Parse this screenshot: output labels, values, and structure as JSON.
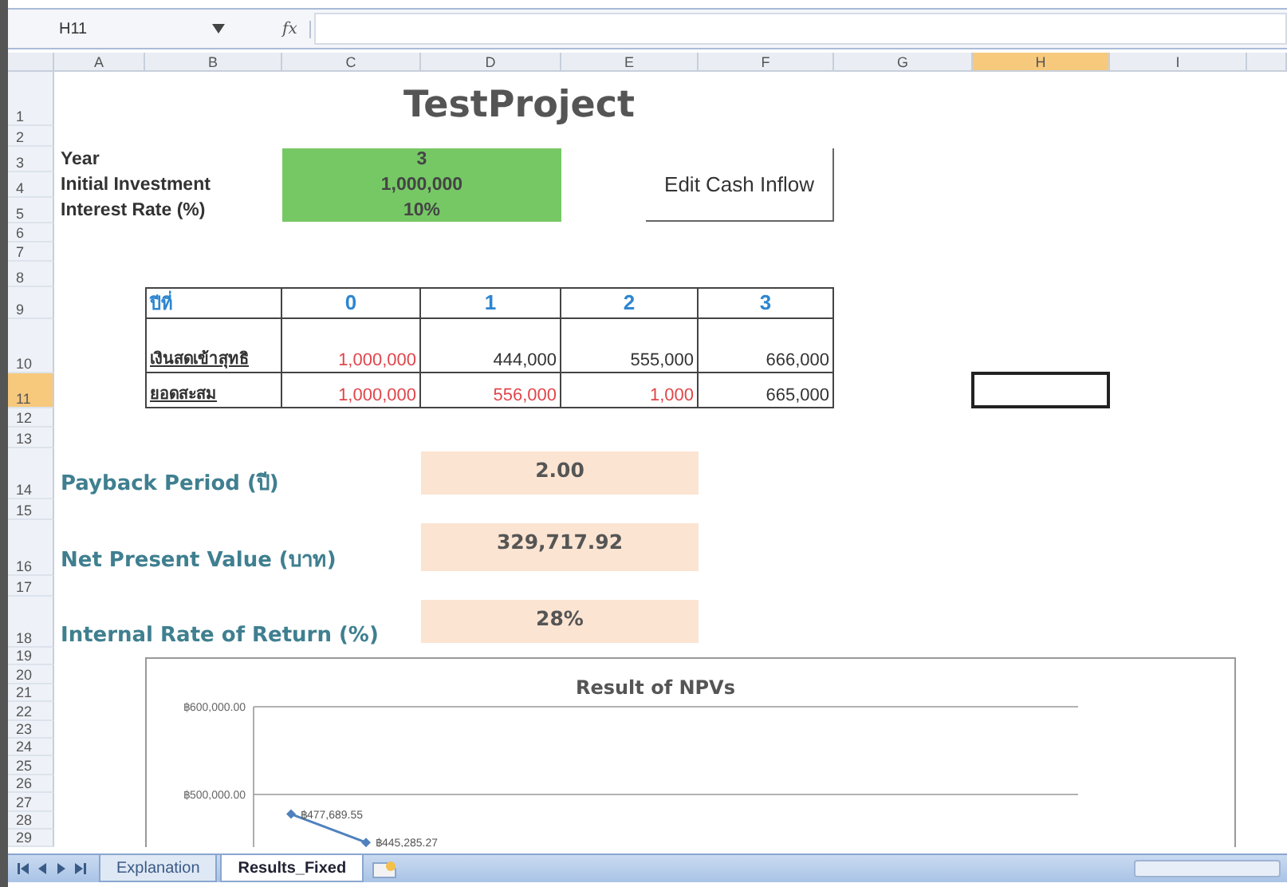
{
  "formula_bar": {
    "name_box": "H11",
    "function_symbol": "fx"
  },
  "columns": [
    {
      "label": "A",
      "selected": false
    },
    {
      "label": "B",
      "selected": false
    },
    {
      "label": "C",
      "selected": false
    },
    {
      "label": "D",
      "selected": false
    },
    {
      "label": "E",
      "selected": false
    },
    {
      "label": "F",
      "selected": false
    },
    {
      "label": "G",
      "selected": false
    },
    {
      "label": "H",
      "selected": true
    },
    {
      "label": "I",
      "selected": false
    }
  ],
  "rows": [
    {
      "label": "1",
      "selected": false
    },
    {
      "label": "2",
      "selected": false
    },
    {
      "label": "3",
      "selected": false
    },
    {
      "label": "4",
      "selected": false
    },
    {
      "label": "5",
      "selected": false
    },
    {
      "label": "6",
      "selected": false
    },
    {
      "label": "7",
      "selected": false
    },
    {
      "label": "8",
      "selected": false
    },
    {
      "label": "9",
      "selected": false
    },
    {
      "label": "10",
      "selected": false
    },
    {
      "label": "11",
      "selected": true
    },
    {
      "label": "12",
      "selected": false
    },
    {
      "label": "13",
      "selected": false
    },
    {
      "label": "14",
      "selected": false
    },
    {
      "label": "15",
      "selected": false
    },
    {
      "label": "16",
      "selected": false
    },
    {
      "label": "17",
      "selected": false
    },
    {
      "label": "18",
      "selected": false
    },
    {
      "label": "19",
      "selected": false
    },
    {
      "label": "20",
      "selected": false
    },
    {
      "label": "21",
      "selected": false
    },
    {
      "label": "22",
      "selected": false
    },
    {
      "label": "23",
      "selected": false
    },
    {
      "label": "24",
      "selected": false
    },
    {
      "label": "25",
      "selected": false
    },
    {
      "label": "26",
      "selected": false
    },
    {
      "label": "27",
      "selected": false
    },
    {
      "label": "28",
      "selected": false
    },
    {
      "label": "29",
      "selected": false
    }
  ],
  "title": "TestProject",
  "inputs": [
    {
      "label": "Year",
      "value": "3"
    },
    {
      "label": "Initial Investment",
      "value": "1,000,000"
    },
    {
      "label": "Interest Rate (%)",
      "value": "10%"
    }
  ],
  "edit_button": "Edit Cash Inflow",
  "cash_table": {
    "header": [
      "ปีที่",
      "0",
      "1",
      "2",
      "3"
    ],
    "rows": [
      {
        "label": "เงินสดเข้าสุทธิ",
        "cells": [
          {
            "text": "1,000,000",
            "negative": true
          },
          {
            "text": "444,000",
            "negative": false
          },
          {
            "text": "555,000",
            "negative": false
          },
          {
            "text": "666,000",
            "negative": false
          }
        ]
      },
      {
        "label": "ยอดสะสม",
        "cells": [
          {
            "text": "1,000,000",
            "negative": true
          },
          {
            "text": "556,000",
            "negative": true
          },
          {
            "text": "1,000",
            "negative": true
          },
          {
            "text": "665,000",
            "negative": false
          }
        ]
      }
    ]
  },
  "results": [
    {
      "label": "Payback Period (ปี)",
      "value": "2.00"
    },
    {
      "label": "Net Present Value (บาท)",
      "value": "329,717.92"
    },
    {
      "label": "Internal Rate of Return (%)",
      "value": "28%"
    }
  ],
  "chart": {
    "chart_data": {
      "type": "line",
      "title": "Result of NPVs",
      "series": [
        {
          "color": "#4f81bd",
          "marker": "diamond",
          "values": [
            477689.55,
            445285.27,
            null,
            null,
            null,
            null,
            null,
            null,
            null,
            null,
            null
          ]
        }
      ],
      "categories": [
        null,
        null,
        null,
        null,
        null,
        null,
        null,
        null,
        null,
        null,
        null
      ],
      "ylim": [
        400000,
        600000
      ],
      "yticks": [
        {
          "value": 500000,
          "label": "฿500,000.00"
        },
        {
          "value": 600000,
          "label": "฿600,000.00"
        }
      ],
      "value_labels": [
        "฿477,689.55",
        "฿445,285.27"
      ]
    }
  },
  "sheet_tabs": [
    {
      "label": "Explanation",
      "selected": false
    },
    {
      "label": "Results_Fixed",
      "selected": true
    }
  ]
}
